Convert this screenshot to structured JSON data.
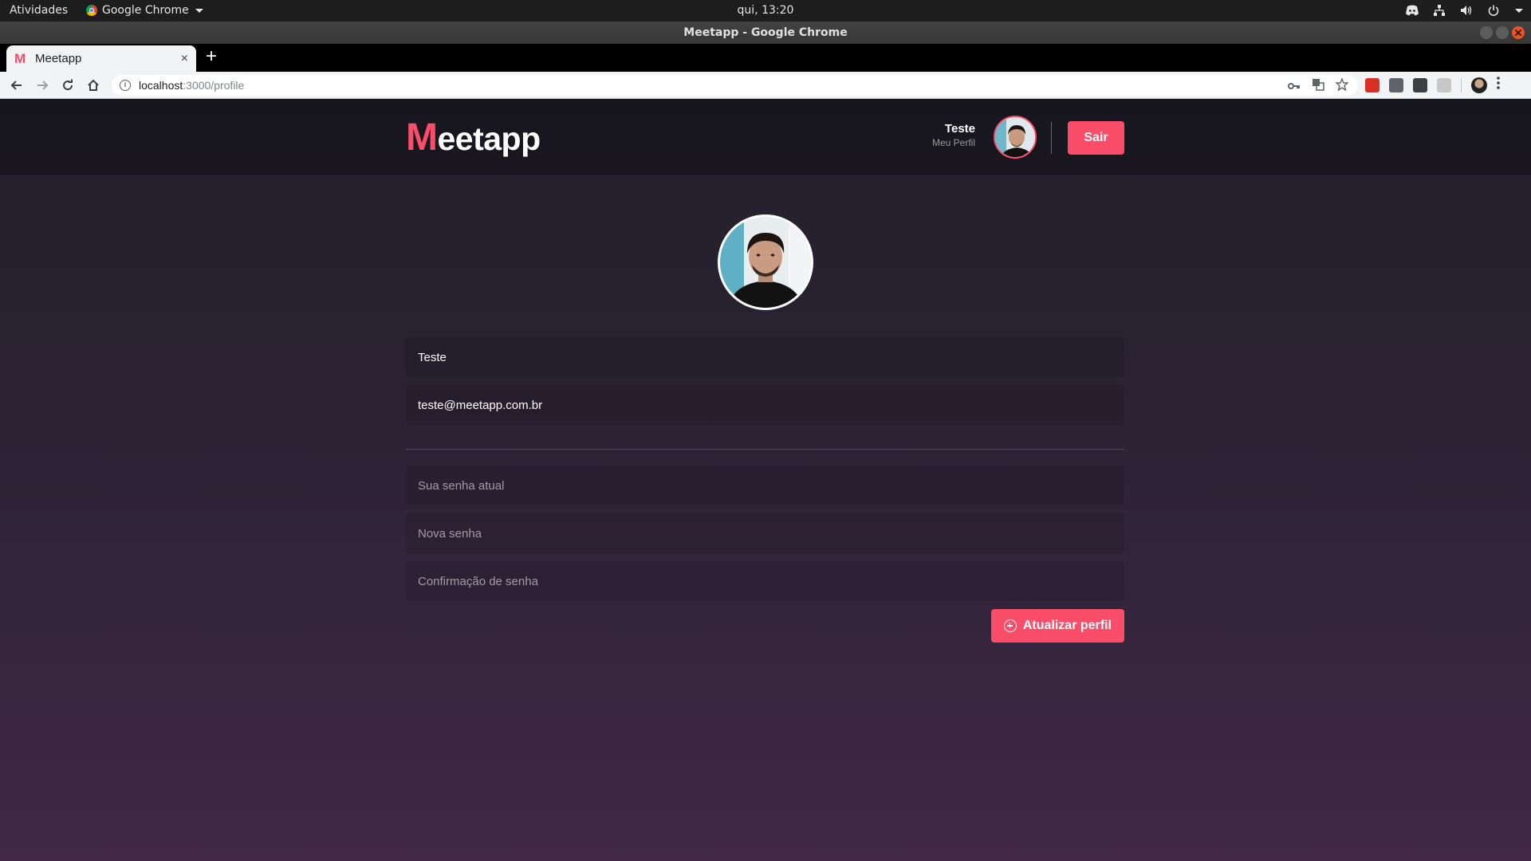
{
  "gnome": {
    "activities": "Atividades",
    "app_name": "Google Chrome",
    "clock": "qui, 13:20"
  },
  "window": {
    "title": "Meetapp - Google Chrome"
  },
  "tab": {
    "favicon": "M",
    "title": "Meetapp",
    "close": "×"
  },
  "newtab": "+",
  "omnibox": {
    "host": "localhost",
    "path": ":3000/profile"
  },
  "app": {
    "logo_m": "M",
    "logo_rest": "eetapp",
    "user_name": "Teste",
    "profile_link": "Meu Perfil",
    "logout_label": "Sair"
  },
  "form": {
    "name_value": "Teste",
    "email_value": "teste@meetapp.com.br",
    "old_password_placeholder": "Sua senha atual",
    "new_password_placeholder": "Nova senha",
    "confirm_password_placeholder": "Confirmação de senha",
    "submit_label": "Atualizar perfil"
  },
  "colors": {
    "accent": "#f94d6a",
    "header_bg": "#1b1a21"
  }
}
